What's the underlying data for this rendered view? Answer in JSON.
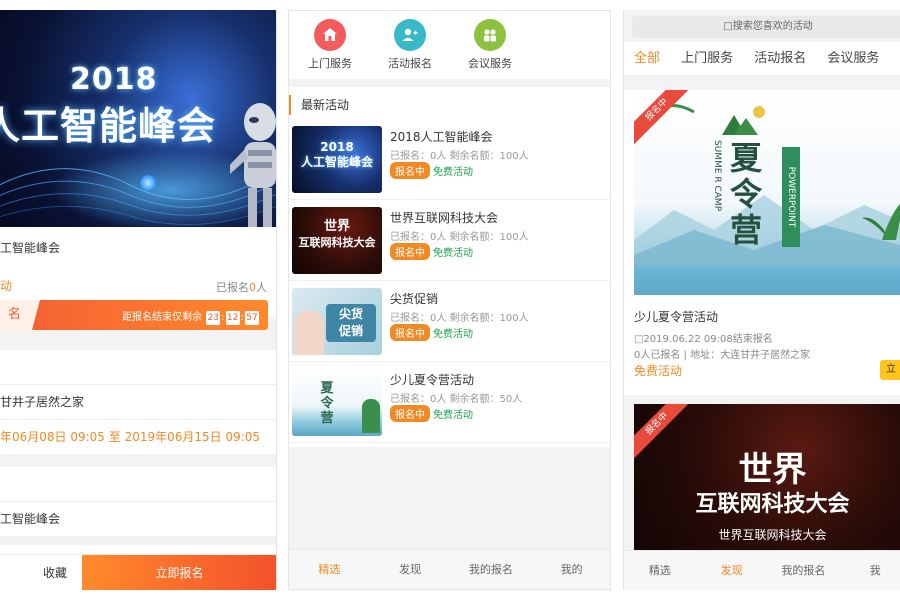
{
  "left": {
    "banner": {
      "year": "2018",
      "title": "人工智能峰会"
    },
    "event_title": "工智能峰会",
    "free_label": "动",
    "signed": {
      "prefix": "已报名",
      "count": "0",
      "suffix": "人"
    },
    "countdown": {
      "tag": "名",
      "label": "距报名结束仅剩余",
      "h": "23",
      "m": "12",
      "s": "57"
    },
    "rows": {
      "r1": "",
      "r2": "甘井子居然之家",
      "r3": "年06月08日 09:05 至 2019年06月15日 09:05",
      "r4": "",
      "r5": "工智能峰会",
      "r6": ""
    },
    "footer": {
      "favorite": "收藏",
      "join": "立即报名"
    }
  },
  "middle": {
    "nav": [
      {
        "label": "上门服务",
        "color": "#f25c5c"
      },
      {
        "label": "活动报名",
        "color": "#39b9c8"
      },
      {
        "label": "会议服务",
        "color": "#8cc23f"
      }
    ],
    "section_title": "最新活动",
    "items": [
      {
        "title": "2018人工智能峰会",
        "meta": "已报名：0人 剩余名额：100人",
        "status": "报名中",
        "price": "免费活动",
        "thumb_text": "2018 人工智能峰会"
      },
      {
        "title": "世界互联网科技大会",
        "meta": "已报名：0人 剩余名额：100人",
        "status": "报名中",
        "price": "免费活动",
        "thumb_text": "世界 互联网科技大会"
      },
      {
        "title": "尖货促销",
        "meta": "已报名：0人 剩余名额：100人",
        "status": "报名中",
        "price": "免费活动",
        "thumb_text": "尖货 促销"
      },
      {
        "title": "少儿夏令营活动",
        "meta": "已报名：0人 剩余名额：50人",
        "status": "报名中",
        "price": "免费活动",
        "thumb_text": "夏令营"
      }
    ],
    "tabbar": [
      "精选",
      "发现",
      "我的报名",
      "我的"
    ]
  },
  "right": {
    "search_placeholder": "□搜索您喜欢的活动",
    "tabs": [
      "全部",
      "上门服务",
      "活动报名",
      "会议服务"
    ],
    "card1": {
      "badge": "报名中",
      "img_title": "夏令营",
      "img_en": "SUMME R CAMP",
      "img_pp": "POWERPOINT",
      "title": "少儿夏令营活动",
      "date": "□2019.06.22 09:08结束报名",
      "addr": "0人已报名 | 地址：大连甘井子居然之家",
      "free": "免费活动",
      "button": "立"
    },
    "card2": {
      "badge": "报名中",
      "line1": "世界",
      "line2": "互联网科技大会",
      "line3": "世界互联网科技大会"
    },
    "tabbar": [
      "精选",
      "发现",
      "我的报名",
      "我"
    ]
  },
  "colors": {
    "accent": "#f08a24",
    "green": "#1aa34a",
    "red": "#e84b3c"
  }
}
